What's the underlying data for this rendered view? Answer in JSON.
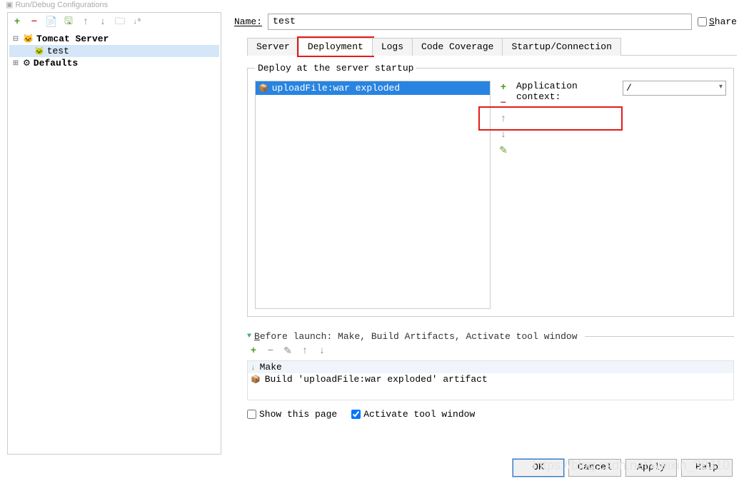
{
  "window": {
    "title": "Run/Debug Configurations"
  },
  "sidebar": {
    "items": [
      {
        "label": "Tomcat Server",
        "kind": "folder",
        "expanded": true,
        "bold": true
      },
      {
        "label": "test",
        "kind": "leaf",
        "indent": 1,
        "selected": true
      },
      {
        "label": "Defaults",
        "kind": "folder",
        "expanded": false,
        "bold": true
      }
    ]
  },
  "name": {
    "label": "Name:",
    "value": "test"
  },
  "share": {
    "label": "Share"
  },
  "tabs": {
    "items": [
      "Server",
      "Deployment",
      "Logs",
      "Code Coverage",
      "Startup/Connection"
    ],
    "active": 1
  },
  "deploy": {
    "legend": "Deploy at the server startup",
    "items": [
      "uploadFile:war exploded"
    ],
    "context_label": "Application context:",
    "context_value": "/"
  },
  "before_launch": {
    "header": "Before launch: Make, Build Artifacts, Activate tool window",
    "items": [
      {
        "icon": "make",
        "label": "Make"
      },
      {
        "icon": "build",
        "label": "Build 'uploadFile:war exploded' artifact"
      }
    ]
  },
  "checks": {
    "show_page": "Show this page",
    "activate": "Activate tool window"
  },
  "buttons": {
    "ok": "OK",
    "cancel": "Cancel",
    "apply": "Apply",
    "help": "Help"
  },
  "watermark": "https://blog.csdn.net/weixin_38310"
}
